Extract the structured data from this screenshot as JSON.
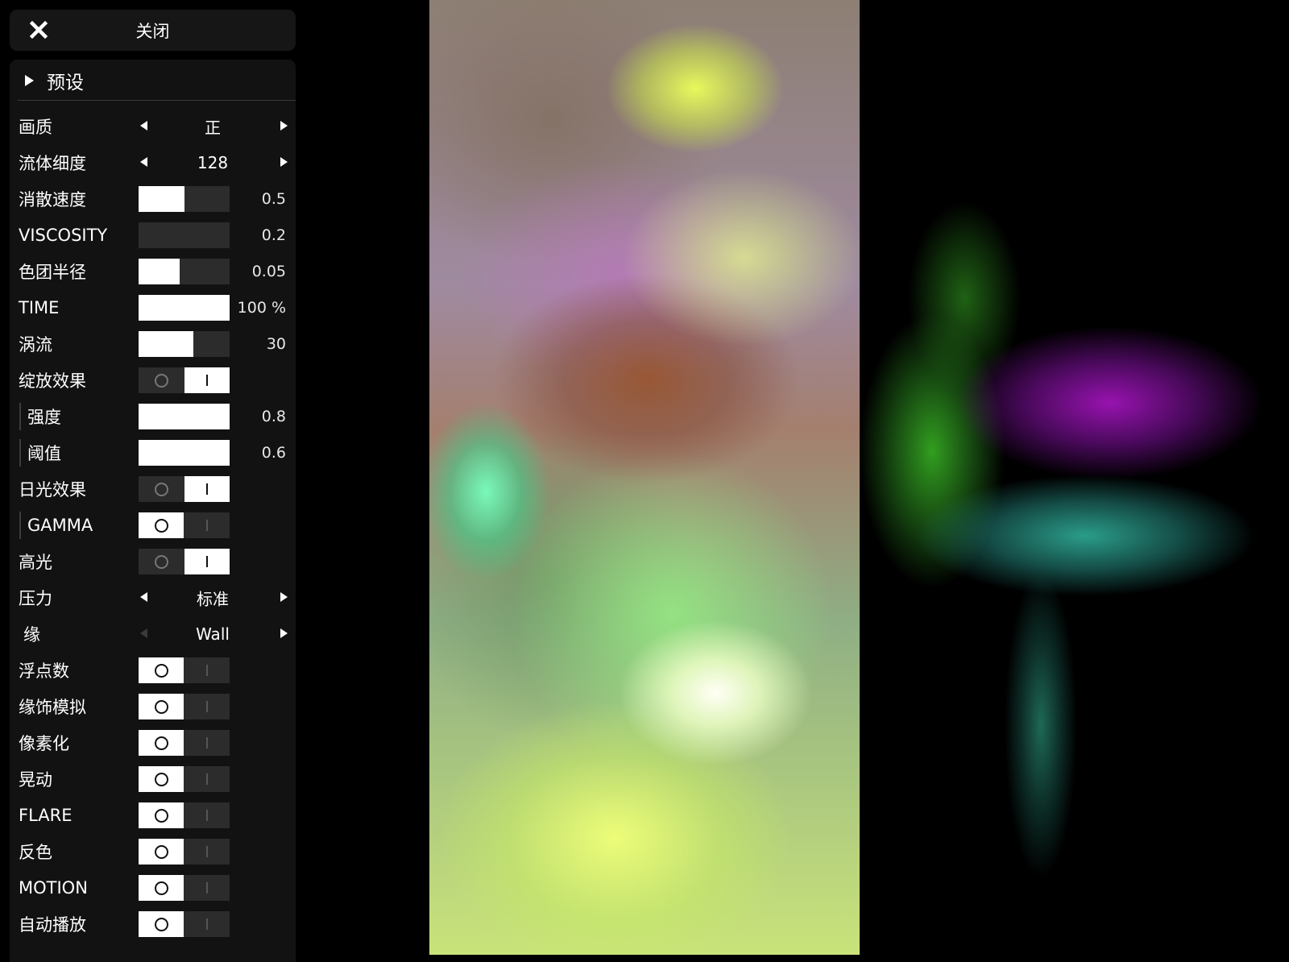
{
  "topbar": {
    "close_label": "关闭"
  },
  "panel": {
    "preset_label": "预设",
    "quality": {
      "label": "画质",
      "value": "正"
    },
    "sim_resolution": {
      "label": "流体细度",
      "value": "128"
    },
    "density_diffusion": {
      "label": "消散速度",
      "value": "0.5",
      "fill": 0.5
    },
    "viscosity": {
      "label": "VISCOSITY",
      "value": "0.2",
      "fill": 0.0
    },
    "splat_radius": {
      "label": "色团半径",
      "value": "0.05",
      "fill": 0.45
    },
    "time": {
      "label": "TIME",
      "value": "100 %",
      "fill": 1.0
    },
    "curl": {
      "label": "涡流",
      "value": "30",
      "fill": 0.6
    },
    "bloom": {
      "label": "绽放效果",
      "on": true
    },
    "bloom_intensity": {
      "label": "强度",
      "value": "0.8",
      "fill": 1.0
    },
    "bloom_threshold": {
      "label": "阈值",
      "value": "0.6",
      "fill": 1.0
    },
    "sunrays": {
      "label": "日光效果",
      "on": true
    },
    "gamma": {
      "label": "GAMMA",
      "on": false
    },
    "shading": {
      "label": "高光",
      "on": true
    },
    "pressure": {
      "label": "压力",
      "value": "标准"
    },
    "boundary": {
      "label": "缘",
      "value": "Wall"
    },
    "float": {
      "label": "浮点数",
      "on": false
    },
    "edge_sim": {
      "label": "缘饰模拟",
      "on": false
    },
    "pixelate": {
      "label": "像素化",
      "on": false
    },
    "wobble": {
      "label": "晃动",
      "on": false
    },
    "flare": {
      "label": "FLARE",
      "on": false
    },
    "invert": {
      "label": "反色",
      "on": false
    },
    "motion": {
      "label": "MOTION",
      "on": false
    },
    "autoplay": {
      "label": "自动播放",
      "on": false
    }
  }
}
